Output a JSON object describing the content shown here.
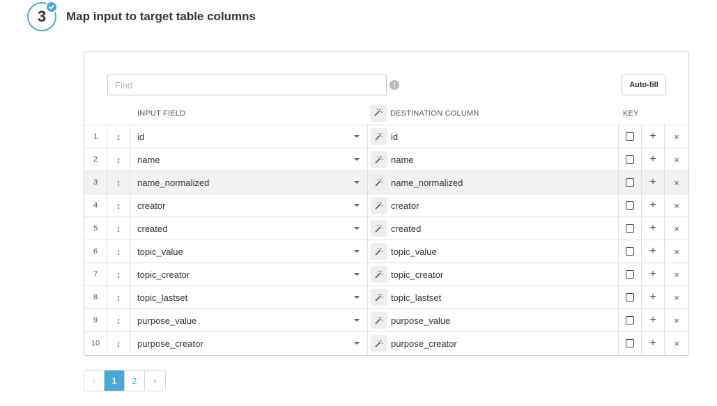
{
  "step": {
    "number": "3",
    "title": "Map input to target table columns",
    "accent_color": "#4aa7d8"
  },
  "toolbar": {
    "find_placeholder": "Find",
    "find_value": "",
    "info_icon": "info-icon",
    "autofill_label": "Auto-fill"
  },
  "headers": {
    "input_field": "INPUT FIELD",
    "destination_column": "DESTINATION COLUMN",
    "key": "KEY"
  },
  "rows": [
    {
      "num": "1",
      "input": "id",
      "dest": "id",
      "key": false
    },
    {
      "num": "2",
      "input": "name",
      "dest": "name",
      "key": false
    },
    {
      "num": "3",
      "input": "name_normalized",
      "dest": "name_normalized",
      "key": false,
      "highlighted": true
    },
    {
      "num": "4",
      "input": "creator",
      "dest": "creator",
      "key": false
    },
    {
      "num": "5",
      "input": "created",
      "dest": "created",
      "key": false
    },
    {
      "num": "6",
      "input": "topic_value",
      "dest": "topic_value",
      "key": false
    },
    {
      "num": "7",
      "input": "topic_creator",
      "dest": "topic_creator",
      "key": false
    },
    {
      "num": "8",
      "input": "topic_lastset",
      "dest": "topic_lastset",
      "key": false
    },
    {
      "num": "9",
      "input": "purpose_value",
      "dest": "purpose_value",
      "key": false
    },
    {
      "num": "10",
      "input": "purpose_creator",
      "dest": "purpose_creator",
      "key": false
    }
  ],
  "row_actions": {
    "drag_glyph": "↕",
    "add_glyph": "+",
    "remove_glyph": "×"
  },
  "pagination": {
    "prev": "‹",
    "pages": [
      "1",
      "2"
    ],
    "current": "1",
    "next": "›"
  }
}
